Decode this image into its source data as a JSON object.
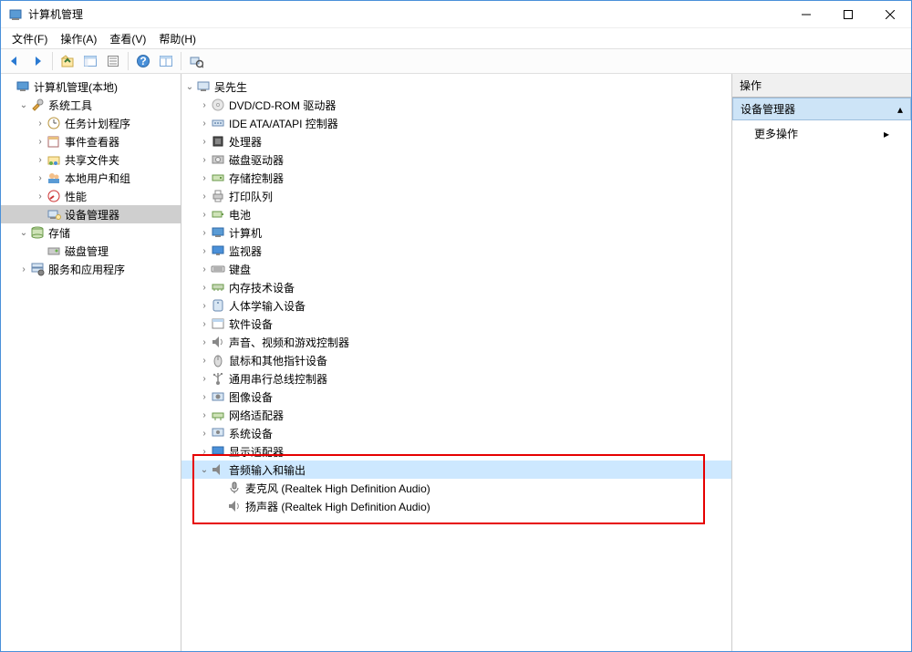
{
  "window": {
    "title": "计算机管理"
  },
  "menu": {
    "file": "文件(F)",
    "action": "操作(A)",
    "view": "查看(V)",
    "help": "帮助(H)"
  },
  "leftTree": {
    "root": "计算机管理(本地)",
    "sysTools": "系统工具",
    "taskScheduler": "任务计划程序",
    "eventViewer": "事件查看器",
    "sharedFolders": "共享文件夹",
    "localUsers": "本地用户和组",
    "performance": "性能",
    "deviceManager": "设备管理器",
    "storage": "存储",
    "diskMgmt": "磁盘管理",
    "services": "服务和应用程序"
  },
  "devices": {
    "root": "吴先生",
    "items": [
      {
        "label": "DVD/CD-ROM 驱动器",
        "icon": "disc"
      },
      {
        "label": "IDE ATA/ATAPI 控制器",
        "icon": "ide"
      },
      {
        "label": "处理器",
        "icon": "cpu"
      },
      {
        "label": "磁盘驱动器",
        "icon": "hdd"
      },
      {
        "label": "存储控制器",
        "icon": "storage"
      },
      {
        "label": "打印队列",
        "icon": "printer"
      },
      {
        "label": "电池",
        "icon": "battery"
      },
      {
        "label": "计算机",
        "icon": "computer"
      },
      {
        "label": "监视器",
        "icon": "monitor"
      },
      {
        "label": "键盘",
        "icon": "keyboard"
      },
      {
        "label": "内存技术设备",
        "icon": "mem"
      },
      {
        "label": "人体学输入设备",
        "icon": "hid"
      },
      {
        "label": "软件设备",
        "icon": "soft"
      },
      {
        "label": "声音、视频和游戏控制器",
        "icon": "sound"
      },
      {
        "label": "鼠标和其他指针设备",
        "icon": "mouse"
      },
      {
        "label": "通用串行总线控制器",
        "icon": "usb"
      },
      {
        "label": "图像设备",
        "icon": "image"
      },
      {
        "label": "网络适配器",
        "icon": "net"
      },
      {
        "label": "系统设备",
        "icon": "sys"
      },
      {
        "label": "显示适配器",
        "icon": "display"
      }
    ],
    "audio": {
      "label": "音频输入和输出",
      "children": [
        {
          "label": "麦克风 (Realtek High Definition Audio)",
          "icon": "mic"
        },
        {
          "label": "扬声器 (Realtek High Definition Audio)",
          "icon": "speaker"
        }
      ]
    }
  },
  "actions": {
    "header": "操作",
    "panelTitle": "设备管理器",
    "more": "更多操作"
  }
}
